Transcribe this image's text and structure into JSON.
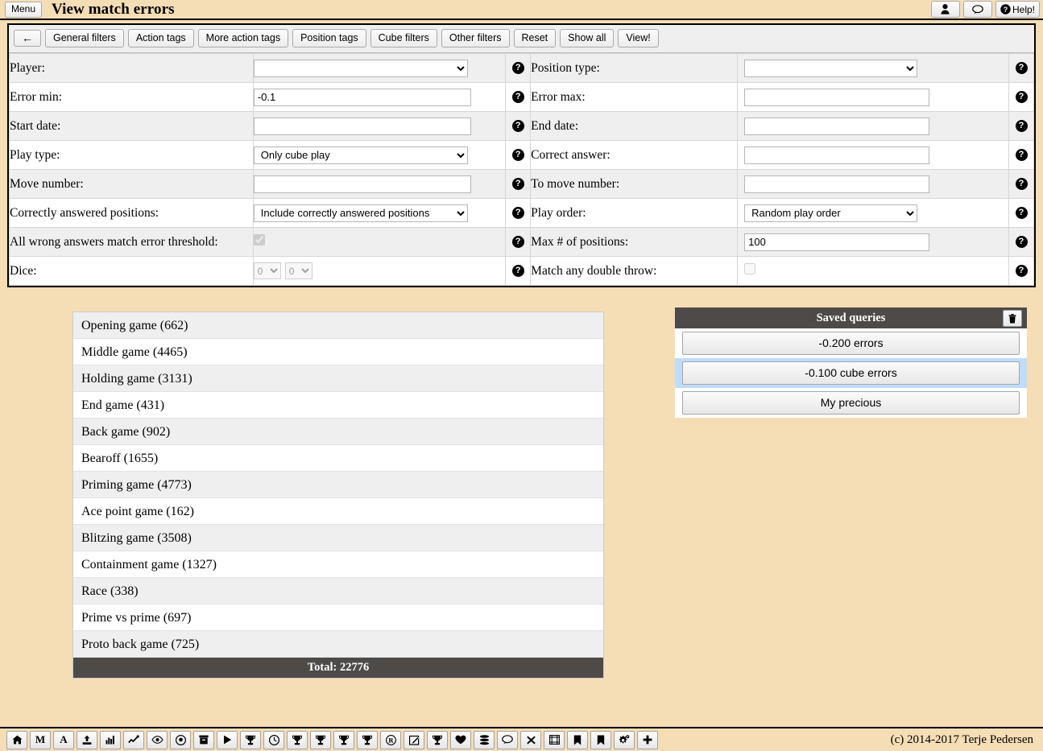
{
  "header": {
    "menu_label": "Menu",
    "title": "View match errors",
    "user_icon": "user-icon",
    "chat_icon": "speech-bubble-icon",
    "help_label": "Help!",
    "help_icon": "question-circle-icon"
  },
  "filter_toolbar": {
    "back_icon": "arrow-left-icon",
    "buttons": [
      "General filters",
      "Action tags",
      "More action tags",
      "Position tags",
      "Cube filters",
      "Other filters",
      "Reset",
      "Show all",
      "View!"
    ]
  },
  "filters": {
    "help_glyph": "?",
    "rows": [
      {
        "left": {
          "label": "Player:",
          "type": "select",
          "value": ""
        },
        "right": {
          "label": "Position type:",
          "type": "select",
          "value": ""
        }
      },
      {
        "left": {
          "label": "Error min:",
          "type": "text",
          "value": "-0.1"
        },
        "right": {
          "label": "Error max:",
          "type": "text",
          "value": ""
        }
      },
      {
        "left": {
          "label": "Start date:",
          "type": "text",
          "value": ""
        },
        "right": {
          "label": "End date:",
          "type": "text",
          "value": ""
        }
      },
      {
        "left": {
          "label": "Play type:",
          "type": "select",
          "value": "Only cube play"
        },
        "right": {
          "label": "Correct answer:",
          "type": "text",
          "value": ""
        }
      },
      {
        "left": {
          "label": "Move number:",
          "type": "text",
          "value": ""
        },
        "right": {
          "label": "To move number:",
          "type": "text",
          "value": ""
        }
      },
      {
        "left": {
          "label": "Correctly answered positions:",
          "type": "select",
          "value": "Include correctly answered positions"
        },
        "right": {
          "label": "Play order:",
          "type": "select",
          "value": "Random play order"
        }
      },
      {
        "left": {
          "label": "All wrong answers match error threshold:",
          "type": "checkbox",
          "value": "checked"
        },
        "right": {
          "label": "Max # of positions:",
          "type": "text",
          "value": "100"
        }
      },
      {
        "left": {
          "label": "Dice:",
          "type": "dice",
          "value": "0",
          "value2": "0"
        },
        "right": {
          "label": "Match any double throw:",
          "type": "checkbox",
          "value": "unchecked"
        }
      }
    ]
  },
  "position_types": {
    "rows": [
      {
        "label": "Opening game (662)"
      },
      {
        "label": "Middle game (4465)"
      },
      {
        "label": "Holding game (3131)"
      },
      {
        "label": "End game (431)"
      },
      {
        "label": "Back game (902)"
      },
      {
        "label": "Bearoff (1655)"
      },
      {
        "label": "Priming game (4773)"
      },
      {
        "label": "Ace point game (162)"
      },
      {
        "label": "Blitzing game (3508)"
      },
      {
        "label": "Containment game (1327)"
      },
      {
        "label": "Race (338)"
      },
      {
        "label": "Prime vs prime (697)"
      },
      {
        "label": "Proto back game (725)"
      }
    ],
    "total": "Total: 22776"
  },
  "saved_queries": {
    "title": "Saved queries",
    "delete_icon": "trash-icon",
    "items": [
      {
        "label": "-0.200 errors",
        "selected": false
      },
      {
        "label": "-0.100 cube errors",
        "selected": true
      },
      {
        "label": "My precious",
        "selected": false
      }
    ]
  },
  "bottom_toolbar": {
    "icons": [
      "home-icon",
      "letter-m-icon",
      "letter-a-icon",
      "upload-icon",
      "bar-chart-icon",
      "line-chart-icon",
      "eye-icon",
      "soccer-ball-icon",
      "archive-icon",
      "play-icon",
      "trophy-icon",
      "clock-icon",
      "trophy-icon",
      "trophy-icon",
      "trophy-icon",
      "trophy-icon",
      "registered-icon",
      "edit-icon",
      "trophy-icon",
      "heart-icon",
      "database-icon",
      "speech-bubble-icon",
      "close-icon",
      "film-icon",
      "bookmark-icon",
      "bookmark-icon",
      "gears-icon",
      "plus-icon"
    ],
    "copyright": "(c) 2014-2017 Terje Pedersen"
  },
  "colors": {
    "page_background": "#f5ddb5",
    "panel_header": "#4d4a48",
    "row_alt": "#efefef",
    "selection": "#bfdcfb"
  }
}
